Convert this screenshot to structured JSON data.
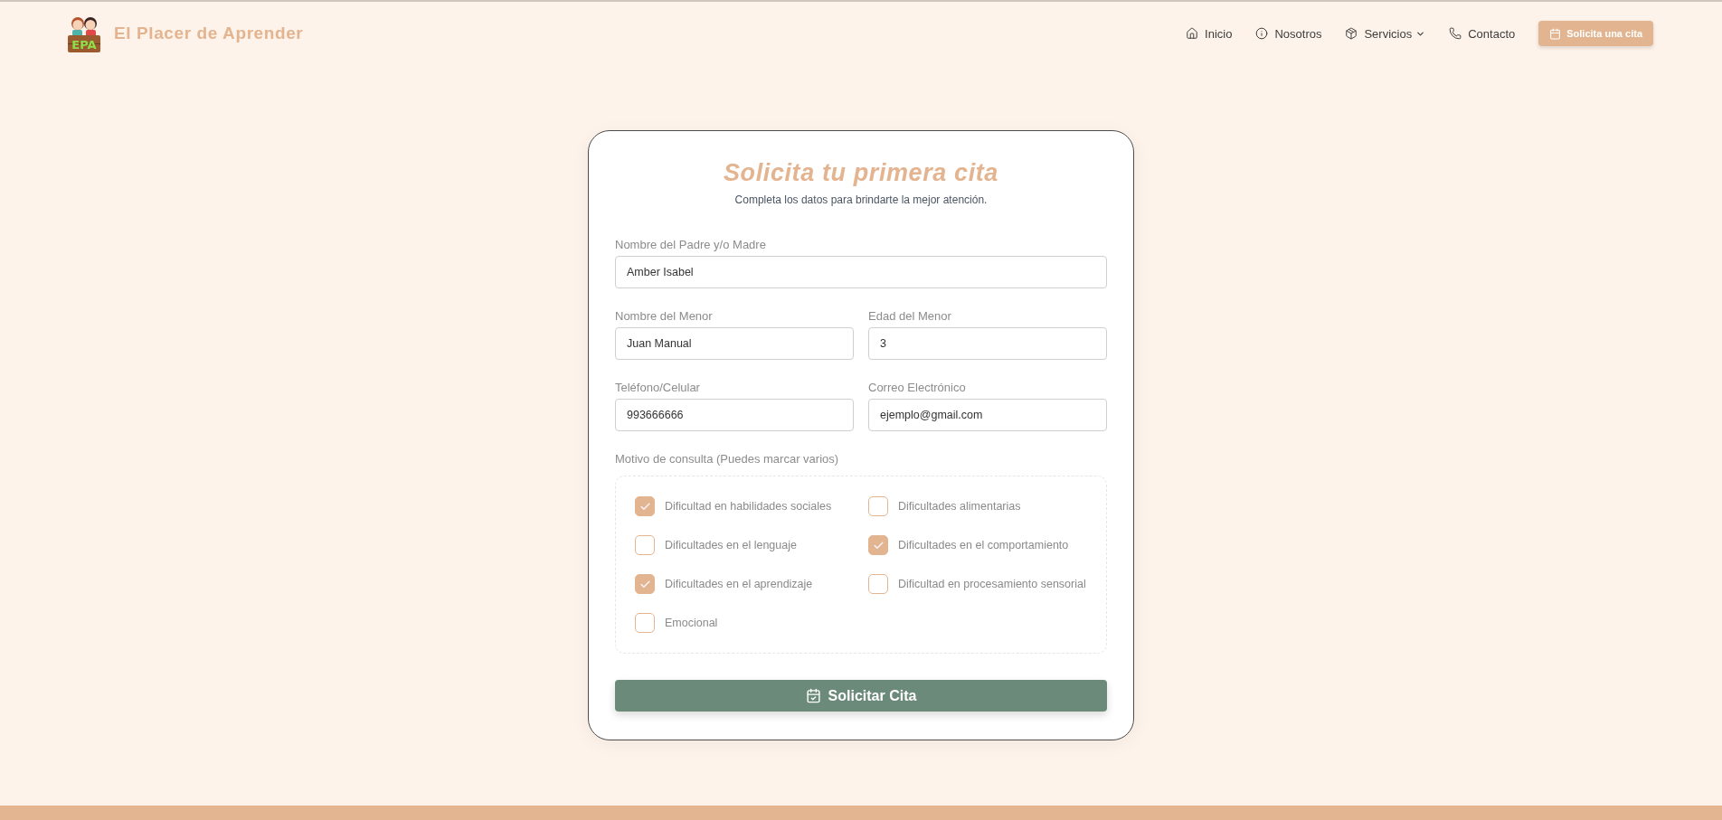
{
  "header": {
    "brand": {
      "logo_text": "EPA",
      "name": "El Placer de Aprender"
    },
    "nav": [
      {
        "label": "Inicio",
        "dropdown": false
      },
      {
        "label": "Nosotros",
        "dropdown": false
      },
      {
        "label": "Servicios",
        "dropdown": true
      },
      {
        "label": "Contacto",
        "dropdown": false
      }
    ],
    "cta": {
      "label": "Solicita una cita"
    }
  },
  "form": {
    "title": "Solicita tu primera cita",
    "subtitle": "Completa los datos para brindarte la mejor atención.",
    "rows": [
      {
        "fields": [
          {
            "label": "Nombre del Padre y/o Madre",
            "value": "Amber Isabel"
          }
        ]
      },
      {
        "fields": [
          {
            "label": "Nombre del Menor",
            "value": "Juan Manual"
          },
          {
            "label": "Edad del Menor",
            "value": "3"
          }
        ]
      },
      {
        "fields": [
          {
            "label": "Teléfono/Celular",
            "value": "993666666"
          },
          {
            "label": "Correo Electrónico",
            "value": "ejemplo@gmail.com"
          }
        ]
      }
    ],
    "reasons_label": "Motivo de consulta (Puedes marcar varios)",
    "reasons": [
      {
        "label": "Dificultad en habilidades sociales",
        "checked": true
      },
      {
        "label": "Dificultades alimentarias",
        "checked": false
      },
      {
        "label": "Dificultades en el lenguaje",
        "checked": false
      },
      {
        "label": "Dificultades en el comportamiento",
        "checked": true
      },
      {
        "label": "Dificultades en el aprendizaje",
        "checked": true
      },
      {
        "label": "Dificultad en procesamiento sensorial",
        "checked": false
      },
      {
        "label": "Emocional",
        "checked": false
      }
    ],
    "submit": {
      "label": "Solicitar Cita"
    }
  }
}
